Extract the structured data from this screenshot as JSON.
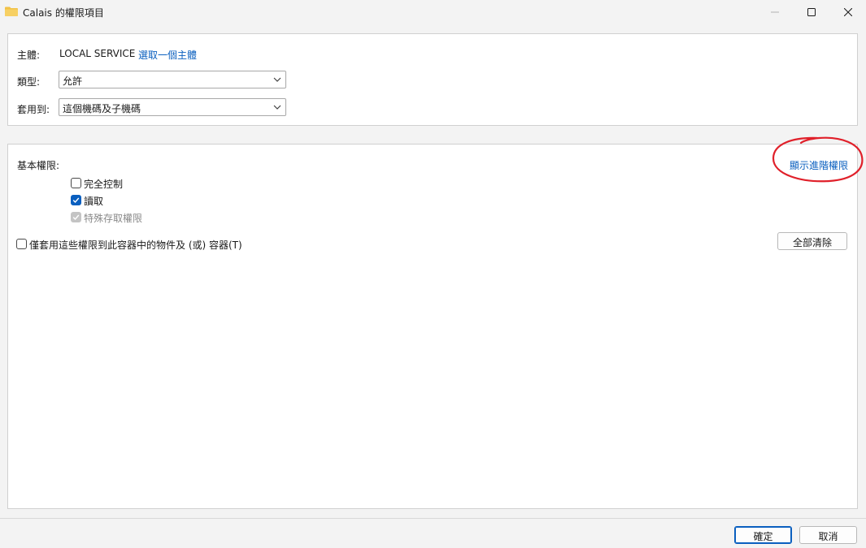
{
  "window": {
    "title": "Calais 的權限項目",
    "folder_color": "#f2c246"
  },
  "top": {
    "principal_label": "主體:",
    "principal_value": "LOCAL SERVICE",
    "select_principal_link": "選取一個主體",
    "type_label": "類型:",
    "type_value": "允許",
    "applies_label": "套用到:",
    "applies_value": "這個機碼及子機碼"
  },
  "permissions": {
    "heading": "基本權限:",
    "show_advanced_link": "顯示進階權限",
    "items": [
      {
        "label": "完全控制",
        "checked": false,
        "disabled": false
      },
      {
        "label": "讀取",
        "checked": true,
        "disabled": false
      },
      {
        "label": "特殊存取權限",
        "checked": true,
        "disabled": true
      }
    ],
    "apply_only_label": "僅套用這些權限到此容器中的物件及 (或) 容器(T)",
    "clear_all_button": "全部清除"
  },
  "footer": {
    "ok_button": "確定",
    "cancel_button": "取消"
  },
  "colors": {
    "accent": "#0a5fbf",
    "annotation": "#e0202a"
  }
}
